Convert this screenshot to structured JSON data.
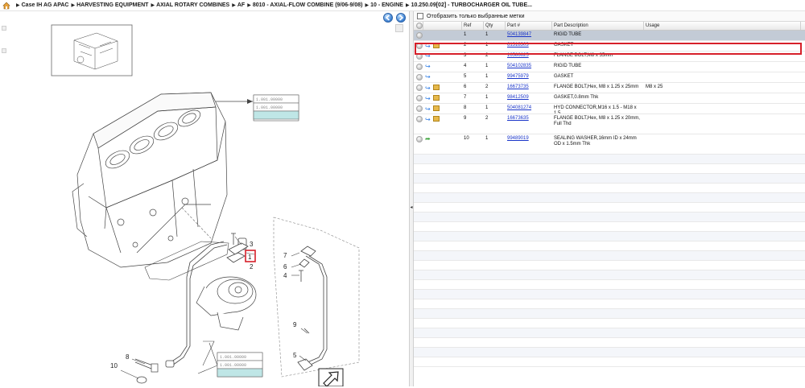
{
  "breadcrumb": [
    "Case IH AG APAC",
    "HARVESTING EQUIPMENT",
    "AXIAL ROTARY COMBINES",
    "AF",
    "8010 - AXIAL-FLOW COMBINE (9/06-9/08)",
    "10 - ENGINE",
    "10.250.09[02] - TURBOCHARGER OIL TUBE..."
  ],
  "filter_label": "Отобразить только выбранные метки",
  "table": {
    "headers": [
      "Ref",
      "Qty",
      "Part #",
      "Part Description",
      "Usage"
    ],
    "rows": [
      {
        "ref": "1",
        "qty": "1",
        "part": "504139847",
        "desc": "RIGID TUBE",
        "usage": "",
        "icons": []
      },
      {
        "ref": "2",
        "qty": "1",
        "part": "61318303",
        "desc": "GASKET",
        "usage": "",
        "icons": [
          "arrow",
          "box"
        ]
      },
      {
        "ref": "3",
        "qty": "2",
        "part": "16586625",
        "desc": "FLANGE BOLT,M8 x 35mm",
        "usage": "",
        "icons": [
          "arrow"
        ]
      },
      {
        "ref": "4",
        "qty": "1",
        "part": "504102835",
        "desc": "RIGID TUBE",
        "usage": "",
        "icons": [
          "arrow"
        ]
      },
      {
        "ref": "5",
        "qty": "1",
        "part": "99475979",
        "desc": "GASKET",
        "usage": "",
        "icons": [
          "arrow"
        ]
      },
      {
        "ref": "6",
        "qty": "2",
        "part": "16673735",
        "desc": "FLANGE BOLT,Hex, M8 x 1.25 x 25mm",
        "usage": "M8 x 25",
        "icons": [
          "arrow",
          "box"
        ]
      },
      {
        "ref": "7",
        "qty": "1",
        "part": "98412509",
        "desc": "GASKET,0.8mm Thk",
        "usage": "",
        "icons": [
          "arrow",
          "box"
        ]
      },
      {
        "ref": "8",
        "qty": "1",
        "part": "504081274",
        "desc": "HYD CONNECTOR,M16 x 1.5 - M18 x 1.5",
        "usage": "",
        "icons": [
          "arrow",
          "box"
        ]
      },
      {
        "ref": "9",
        "qty": "2",
        "part": "16673635",
        "desc": "FLANGE BOLT,Hex, M8 x 1.25 x 20mm, Full Thd",
        "usage": "",
        "icons": [
          "arrow",
          "box"
        ]
      },
      {
        "ref": "10",
        "qty": "1",
        "part": "99489019",
        "desc": "SEALING WASHER,16mm ID x 24mm OD x 1.5mm Thk",
        "usage": "",
        "icons": [
          "green-arrow"
        ]
      }
    ]
  },
  "diagram": {
    "callouts": [
      "1",
      "2",
      "3",
      "4",
      "5",
      "6",
      "7",
      "8",
      "9",
      "10"
    ],
    "highlighted_callout": "1"
  },
  "colors": {
    "selected_row": "#c3cbd6",
    "highlight_border": "#d6202a",
    "link": "#1a35c9",
    "nav_button": "#3b7fd1"
  },
  "icons": {
    "home": "home-icon",
    "back": "back-arrow-icon",
    "forward": "forward-arrow-icon"
  }
}
